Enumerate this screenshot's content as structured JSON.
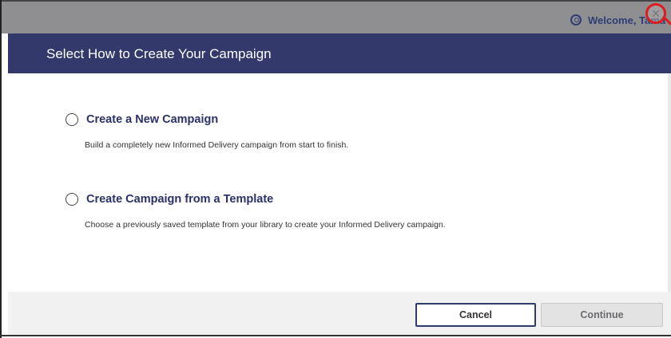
{
  "topbar": {
    "welcome_text": "Welcome, Tama",
    "user_icon": "user-circle-icon",
    "close_symbol": "×"
  },
  "dialog": {
    "title": "Select How to Create Your Campaign",
    "options": [
      {
        "title": "Create a New Campaign",
        "description": "Build a completely new Informed Delivery campaign from start to finish."
      },
      {
        "title": "Create Campaign from a Template",
        "description": "Choose a previously saved template from your library to create your Informed Delivery campaign."
      }
    ],
    "buttons": {
      "cancel": "Cancel",
      "continue": "Continue"
    }
  },
  "colors": {
    "header_bg": "#333a6b",
    "title_text": "#2a3168",
    "highlight": "#e01b1b"
  }
}
